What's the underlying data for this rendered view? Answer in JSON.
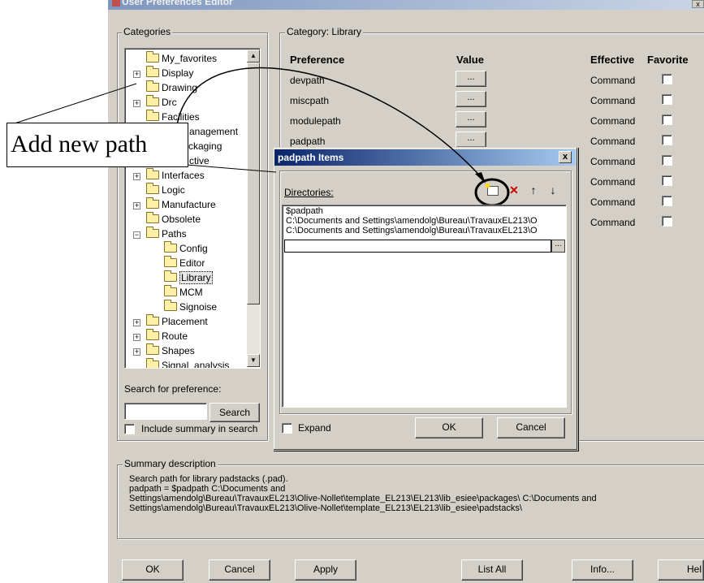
{
  "window": {
    "title": "User Preferences Editor",
    "close_glyph": "x"
  },
  "categories": {
    "legend": "Categories",
    "items": [
      {
        "label": "My_favorites"
      },
      {
        "label": "Display"
      },
      {
        "label": "Drawing"
      },
      {
        "label": "Drc"
      },
      {
        "label": "Facilities"
      },
      {
        "label": "anagement"
      },
      {
        "label": "ckaging"
      },
      {
        "label": "ctive"
      },
      {
        "label": "Interfaces"
      },
      {
        "label": "Logic"
      },
      {
        "label": "Manufacture"
      },
      {
        "label": "Obsolete"
      },
      {
        "label": "Paths"
      },
      {
        "label": "Config"
      },
      {
        "label": "Editor"
      },
      {
        "label": "Library"
      },
      {
        "label": "MCM"
      },
      {
        "label": "Signoise"
      },
      {
        "label": "Placement"
      },
      {
        "label": "Route"
      },
      {
        "label": "Shapes"
      },
      {
        "label": "Signal_analysis"
      }
    ],
    "search_label": "Search for preference:",
    "search_button": "Search",
    "include_summary": "Include summary in search"
  },
  "category_panel": {
    "legend": "Category:  Library",
    "headers": {
      "preference": "Preference",
      "value": "Value",
      "effective": "Effective",
      "favorite": "Favorite"
    },
    "rows": [
      {
        "name": "devpath",
        "value_btn": "...",
        "effective": "Command"
      },
      {
        "name": "miscpath",
        "value_btn": "...",
        "effective": "Command"
      },
      {
        "name": "modulepath",
        "value_btn": "...",
        "effective": "Command"
      },
      {
        "name": "padpath",
        "value_btn": "...",
        "effective": "Command"
      },
      {
        "name": "",
        "value_btn": "",
        "effective": "Command"
      },
      {
        "name": "",
        "value_btn": "",
        "effective": "Command"
      },
      {
        "name": "",
        "value_btn": "",
        "effective": "Command"
      },
      {
        "name": "",
        "value_btn": "",
        "effective": "Command"
      }
    ]
  },
  "dialog": {
    "title": "padpath Items",
    "close_glyph": "x",
    "directories_label": "Directories:",
    "toolbar": {
      "new_icon": "new-folder-icon",
      "delete_icon": "delete-icon",
      "up_icon": "arrow-up-icon",
      "down_icon": "arrow-down-icon",
      "delete_glyph": "✕",
      "up_glyph": "↑",
      "down_glyph": "↓"
    },
    "items": [
      "$padpath",
      "C:\\Documents and Settings\\amendolg\\Bureau\\TravauxEL213\\O",
      "C:\\Documents and Settings\\amendolg\\Bureau\\TravauxEL213\\O"
    ],
    "edit_value": "",
    "edit_browse": "...",
    "expand_label": "Expand",
    "ok": "OK",
    "cancel": "Cancel"
  },
  "annotation": {
    "text": "Add new path"
  },
  "summary": {
    "legend": "Summary description",
    "text": "Search path for library padstacks (.pad).\npadpath = $padpath C:\\Documents and\nSettings\\amendolg\\Bureau\\TravauxEL213\\Olive-Nollet\\template_EL213\\EL213\\lib_esiee\\packages\\ C:\\Documents and\nSettings\\amendolg\\Bureau\\TravauxEL213\\Olive-Nollet\\template_EL213\\EL213\\lib_esiee\\padstacks\\"
  },
  "buttons": {
    "ok": "OK",
    "cancel": "Cancel",
    "apply": "Apply",
    "list_all": "List All",
    "info": "Info...",
    "help": "Hel"
  },
  "colors": {
    "dialog_face": "#d4d0c8",
    "title_active": "#0a246a",
    "highlight_circle": "#000000"
  }
}
